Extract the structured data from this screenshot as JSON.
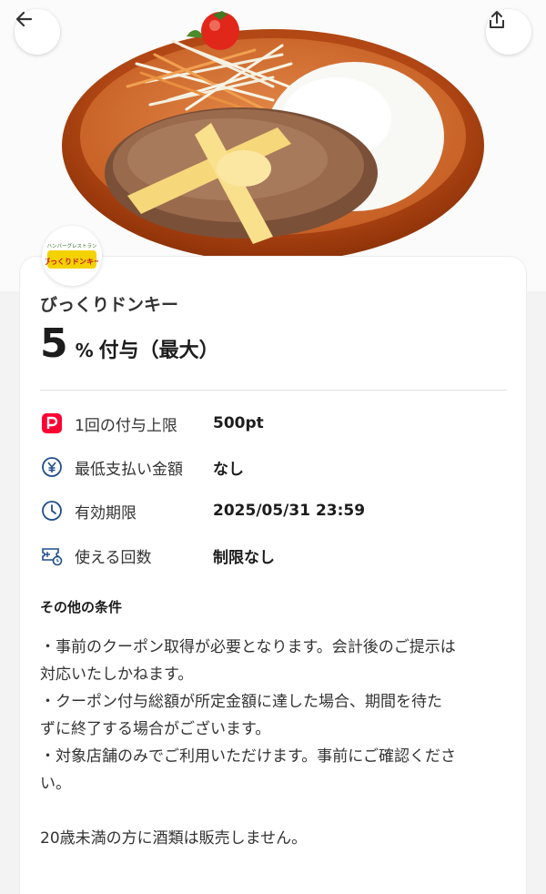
{
  "hero": {
    "image_alt": "ハンバーグ"
  },
  "nav": {
    "back_icon": "arrow-left-icon",
    "share_icon": "share-icon"
  },
  "store": {
    "logo_small": "ハンバーグレストラン",
    "logo_main": "びっくりドンキー",
    "name": "びっくりドンキー"
  },
  "reward": {
    "rate": "5",
    "unit": "%",
    "text": "付与（最大）"
  },
  "details": [
    {
      "icon": "paypay-icon",
      "label": "1回の付与上限",
      "value": "500pt"
    },
    {
      "icon": "yen-icon",
      "label": "最低支払い金額",
      "value": "なし"
    },
    {
      "icon": "clock-icon",
      "label": "有効期限",
      "value": "2025/05/31 23:59"
    },
    {
      "icon": "ticket-icon",
      "label": "使える回数",
      "value": "制限なし"
    }
  ],
  "conditions": {
    "title": "その他の条件",
    "lines": [
      "・事前のクーポン取得が必要となります。会計後のご提示は",
      "対応いたしかねます。",
      "・クーポン付与総額が所定金額に達した場合、期間を待た",
      "ずに終了する場合がございます。",
      "・対象店舗のみでご利用いただけます。事前にご確認くださ",
      "い。",
      "",
      "20歳未満の方に酒類は販売しません。"
    ]
  },
  "colors": {
    "paypay_red": "#ff0033",
    "icon_blue": "#1f4e8c"
  }
}
